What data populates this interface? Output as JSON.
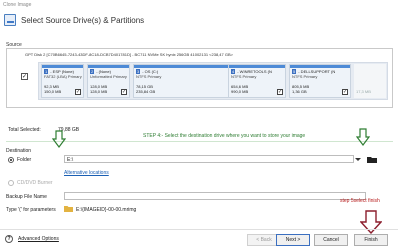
{
  "window": {
    "title": "Clone Image"
  },
  "page": {
    "title": "Select Source Drive(s) & Partitions"
  },
  "source": {
    "label": "Source",
    "disk_header": "GPT Disk 2 [C70B6645-7243-43DF-8C18-DCB7D401781D] - BC711 NVMe SK hynix 256GB 41002131  <238,47 GB>",
    "partitions": [
      {
        "number": "1",
        "name": "- ESP (None)",
        "fs": "FAT32 (LBA) Primary",
        "used": "92,3 MB",
        "total": "150,0 MB",
        "checked": true
      },
      {
        "number": "2",
        "name": "- (None)",
        "fs": "Unformatted Primary",
        "used": "128,0 MB",
        "total": "128,0 MB",
        "checked": true
      },
      {
        "number": "3",
        "name": "- OS (C:)",
        "fs": "NTFS Primary",
        "used": "78,15 GB",
        "total": "235,84 GB",
        "checked": true
      },
      {
        "number": "4",
        "name": "- WINRETOOLS (N",
        "fs": "NTFS Primary",
        "used": "654,6 MB",
        "total": "990,0 MB",
        "checked": true
      },
      {
        "number": "5",
        "name": "- DELLSUPPORT (N",
        "fs": "NTFS Primary",
        "used": "805,5 MB",
        "total": "1,36 GB",
        "checked": true
      }
    ],
    "unallocated": "17,3 MB",
    "disk_checked": true
  },
  "summary": {
    "label": "Total Selected:",
    "value": "79,88 GB"
  },
  "annotation_step4": "STEP 4:- Select the destination drive where you want to store your image",
  "annotation_step5": "step 5select finish",
  "destination": {
    "label": "Destination",
    "folder_label": "Folder",
    "folder_value": "E:\\",
    "alt_locations": "Alternative locations",
    "cd_label": "CD/DVD Burner",
    "backup_name_label": "Backup File Name",
    "backup_name_value": "",
    "params_label": "Type '(' for parameters",
    "params_value": "E:\\{IMAGEID}-00-00.mrimg"
  },
  "footer": {
    "advanced": "Advanced Options",
    "back": "< Back",
    "next": "Next >",
    "cancel": "Cancel",
    "finish": "Finish"
  },
  "colors": {
    "accent": "#3b6fc0",
    "annotation_green": "#2e7d32",
    "annotation_red": "#b71c1c",
    "arrow_red": "#8b1e2d"
  }
}
